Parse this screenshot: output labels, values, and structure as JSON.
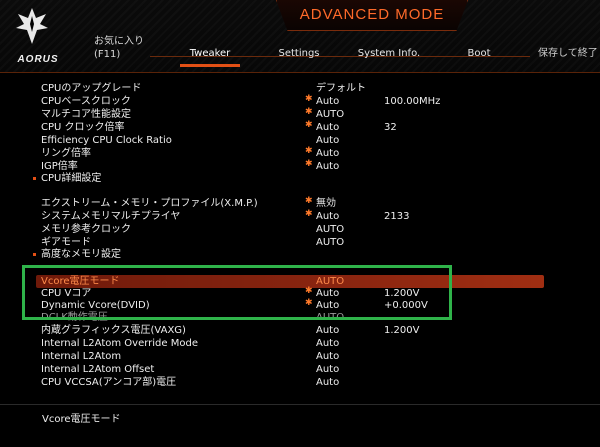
{
  "header": {
    "mode_title": "ADVANCED MODE",
    "brand": "AORUS",
    "favorites": {
      "line1": "お気に入り",
      "line2": "(F11)"
    },
    "tabs": [
      {
        "label": "Tweaker",
        "active": true
      },
      {
        "label": "Settings",
        "active": false
      },
      {
        "label": "System Info.",
        "active": false
      },
      {
        "label": "Boot",
        "active": false
      },
      {
        "label": "保存して終了",
        "active": false
      }
    ]
  },
  "items": [
    {
      "label": "CPUのアップグレード",
      "star": false,
      "value": "デフォルト",
      "value2": ""
    },
    {
      "label": "CPUベースクロック",
      "star": true,
      "value": "Auto",
      "value2": "100.00MHz"
    },
    {
      "label": "マルチコア性能設定",
      "star": true,
      "value": "AUTO",
      "value2": ""
    },
    {
      "label": "CPU クロック倍率",
      "star": true,
      "value": "Auto",
      "value2": "32"
    },
    {
      "label": "Efficiency CPU Clock Ratio",
      "star": false,
      "value": "Auto",
      "value2": ""
    },
    {
      "label": "リング倍率",
      "star": true,
      "value": "Auto",
      "value2": ""
    },
    {
      "label": "IGP倍率",
      "star": true,
      "value": "Auto",
      "value2": ""
    },
    {
      "label": "CPU詳細設定",
      "bullet": true
    },
    {
      "label": "エクストリーム・メモリ・プロファイル(X.M.P.)",
      "star": true,
      "value": "無効",
      "value2": ""
    },
    {
      "label": "システムメモリマルチプライヤ",
      "star": true,
      "value": "Auto",
      "value2": "2133"
    },
    {
      "label": "メモリ参考クロック",
      "star": false,
      "value": "AUTO",
      "value2": ""
    },
    {
      "label": "ギアモード",
      "star": false,
      "value": "AUTO",
      "value2": ""
    },
    {
      "label": "高度なメモリ設定",
      "bullet": true
    },
    {
      "label": "Vcore電圧モード",
      "star": false,
      "value": "AUTO",
      "value2": "",
      "selected": true
    },
    {
      "label": "CPU Vコア",
      "star": true,
      "value": "Auto",
      "value2": "1.200V"
    },
    {
      "label": "Dynamic Vcore(DVID)",
      "star": true,
      "value": "Auto",
      "value2": "+0.000V"
    },
    {
      "label": "DCLK動作電圧",
      "star": false,
      "value": "AUTO",
      "value2": "",
      "dim": true
    },
    {
      "label": "内蔵グラフィックス電圧(VAXG)",
      "star": false,
      "value": "Auto",
      "value2": "1.200V"
    },
    {
      "label": "Internal L2Atom Override Mode",
      "star": false,
      "value": "Auto",
      "value2": ""
    },
    {
      "label": "Internal L2Atom",
      "star": false,
      "value": "Auto",
      "value2": ""
    },
    {
      "label": "Internal L2Atom Offset",
      "star": false,
      "value": "Auto",
      "value2": ""
    },
    {
      "label": "CPU VCCSA(アンコア部)電圧",
      "star": false,
      "value": "Auto",
      "value2": ""
    }
  ],
  "footer": {
    "help_text": "Vcore電圧モード"
  },
  "colors": {
    "accent": "#e35015",
    "highlight_box": "#2fb34a",
    "selected_row": "#8a2510"
  }
}
